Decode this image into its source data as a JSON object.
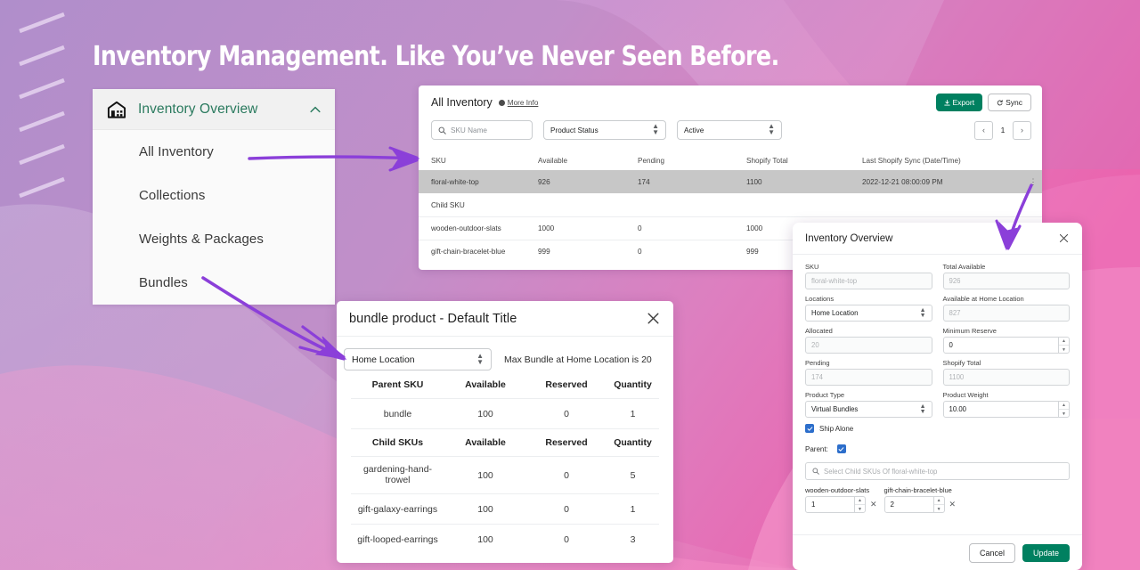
{
  "page": {
    "title": "Inventory Management. Like You’ve Never Seen Before.",
    "accent_purple": "#8b3fd9",
    "accent_green": "#008060",
    "accent_teal": "#2a7a5e",
    "accent_blue": "#2c6ecb"
  },
  "sidebar": {
    "header_label": "Inventory Overview",
    "header_icon": "warehouse-icon",
    "chevron_icon": "chevron-up-icon",
    "items": [
      {
        "label": "All Inventory"
      },
      {
        "label": "Collections"
      },
      {
        "label": "Weights & Packages"
      },
      {
        "label": "Bundles"
      }
    ]
  },
  "inventory": {
    "title": "All Inventory",
    "more_info_label": "More Info",
    "export_label": "Export",
    "sync_label": "Sync",
    "search_placeholder": "SKU Name",
    "product_status_value": "Product Status",
    "active_value": "Active",
    "page_number": "1",
    "columns": [
      "SKU",
      "Available",
      "Pending",
      "Shopify Total",
      "Last Shopify Sync (Date/Time)"
    ],
    "parent_row": {
      "sku": "floral-white-top",
      "available": "926",
      "pending": "174",
      "shopify_total": "1100",
      "last_sync": "2022-12-21 08:00:09 PM"
    },
    "child_group_label": "Child SKU",
    "child_rows": [
      {
        "sku": "wooden-outdoor-slats",
        "available": "1000",
        "pending": "0",
        "shopify_total": "1000",
        "last_sync": ""
      },
      {
        "sku": "gift-chain-bracelet-blue",
        "available": "999",
        "pending": "0",
        "shopify_total": "999",
        "last_sync": ""
      }
    ]
  },
  "bundle_modal": {
    "title": "bundle product - Default Title",
    "location_value": "Home Location",
    "max_text": "Max Bundle at Home Location is 20",
    "parent_columns": [
      "Parent SKU",
      "Available",
      "Reserved",
      "Quantity"
    ],
    "parent_rows": [
      {
        "sku": "bundle",
        "available": "100",
        "reserved": "0",
        "quantity": "1"
      }
    ],
    "child_columns": [
      "Child SKUs",
      "Available",
      "Reserved",
      "Quantity"
    ],
    "child_rows": [
      {
        "sku": "gardening-hand-\ntrowel",
        "available": "100",
        "reserved": "0",
        "quantity": "5"
      },
      {
        "sku": "gift-galaxy-earrings",
        "available": "100",
        "reserved": "0",
        "quantity": "1"
      },
      {
        "sku": "gift-looped-earrings",
        "available": "100",
        "reserved": "0",
        "quantity": "3"
      }
    ]
  },
  "overview_panel": {
    "title": "Inventory Overview",
    "fields": {
      "sku_label": "SKU",
      "sku_value": "floral-white-top",
      "total_available_label": "Total Available",
      "total_available_value": "926",
      "locations_label": "Locations",
      "locations_value": "Home Location",
      "available_home_label": "Available at Home Location",
      "available_home_value": "827",
      "allocated_label": "Allocated",
      "allocated_value": "20",
      "minimum_reserve_label": "Minimum Reserve",
      "minimum_reserve_value": "0",
      "pending_label": "Pending",
      "pending_value": "174",
      "shopify_total_label": "Shopify Total",
      "shopify_total_value": "1100",
      "product_type_label": "Product Type",
      "product_type_value": "Virtual Bundles",
      "product_weight_label": "Product Weight",
      "product_weight_value": "10.00"
    },
    "ship_alone_label": "Ship Alone",
    "parent_label": "Parent:",
    "child_search_placeholder": "Select Child SKUs Of floral-white-top",
    "chips": [
      {
        "name": "wooden-outdoor-slats",
        "qty": "1"
      },
      {
        "name": "gift-chain-bracelet-blue",
        "qty": "2"
      }
    ],
    "cancel_label": "Cancel",
    "update_label": "Update"
  }
}
